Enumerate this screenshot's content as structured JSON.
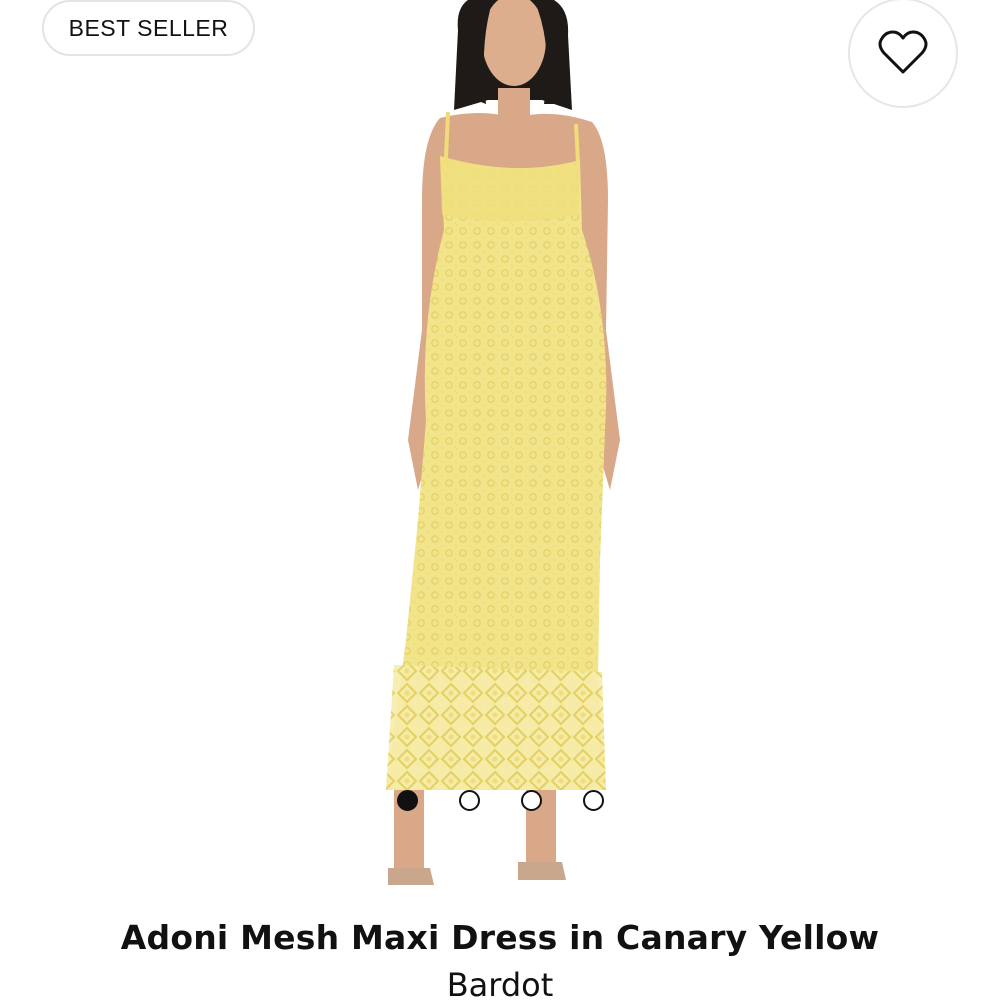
{
  "badge": {
    "label": "BEST SELLER"
  },
  "wishlist": {
    "icon": "heart-outline-icon"
  },
  "gallery": {
    "image_alt": "Model wearing yellow mesh maxi dress",
    "dot_count": 4,
    "active_index": 0
  },
  "product": {
    "title": "Adoni Mesh Maxi Dress in Canary Yellow",
    "brand": "Bardot"
  },
  "colors": {
    "dress": "#f2e48a",
    "skin": "#d9a888",
    "hair": "#1e1a18"
  }
}
